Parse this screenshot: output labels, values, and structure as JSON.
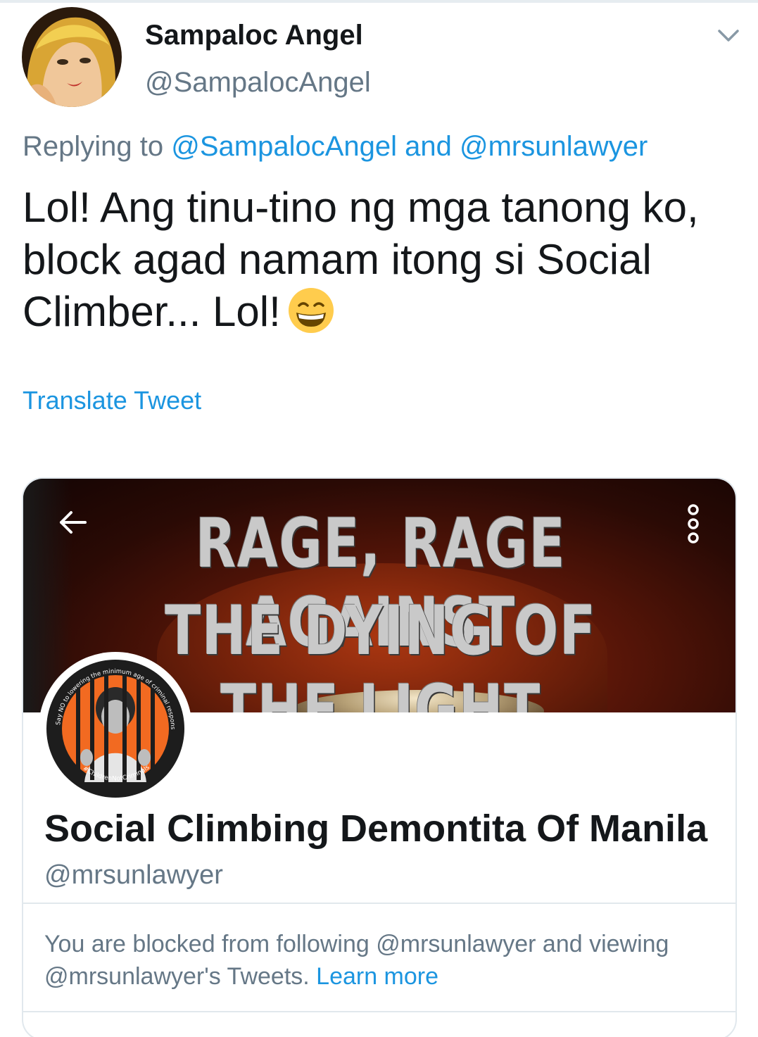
{
  "author": {
    "display_name": "Sampaloc Angel",
    "handle": "@SampalocAngel"
  },
  "reply": {
    "prefix": "Replying to ",
    "mention1": "@SampalocAngel",
    "conjunction": " and ",
    "mention2": "@mrsunlawyer"
  },
  "tweet": {
    "text": "Lol! Ang tinu-tino ng mga tanong ko, block agad namam itong si Social Climber... Lol!",
    "emoji": "grinning-face-with-smiling-eyes",
    "translate_label": "Translate Tweet"
  },
  "card": {
    "banner_line1": "RAGE, RAGE AGAINST",
    "banner_line2": "THE DYING OF THE LIGHT",
    "profile_name": "Social Climbing Demontita Of Manila",
    "profile_handle": "@mrsunlawyer",
    "blocked_text": "You are blocked from following @mrsunlawyer and viewing @mrsunlawyer's Tweets. ",
    "learn_more": "Learn more",
    "avatar_ring_text": "Say NO to lowering the minimum age of criminal responsibility!",
    "avatar_hashtag": "#ChildrenNotCriminals"
  },
  "colors": {
    "link": "#1b95e0",
    "secondary_text": "#657786",
    "primary_text": "#14171a",
    "border": "#e1e8ed",
    "avatar_orange": "#f26a21"
  }
}
